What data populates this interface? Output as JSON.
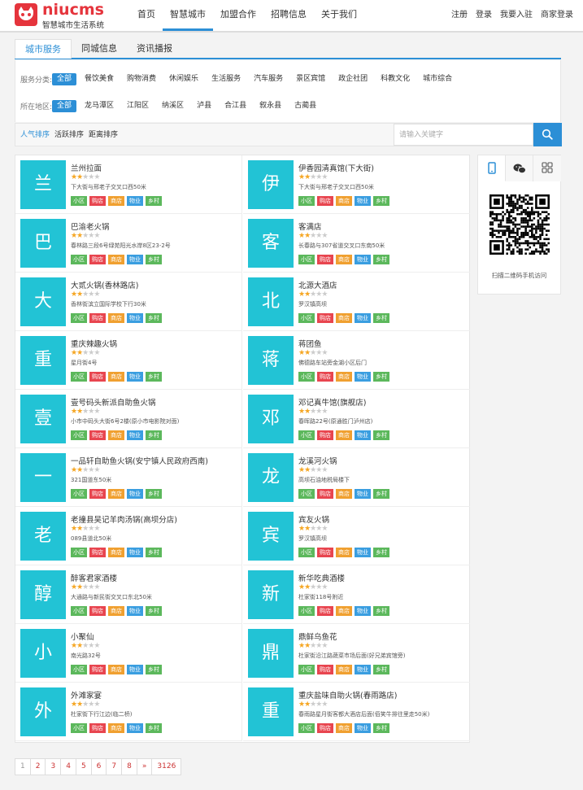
{
  "header": {
    "brand": "niucms",
    "slogan": "智慧城市生活系统",
    "nav": [
      "首页",
      "智慧城市",
      "加盟合作",
      "招聘信息",
      "关于我们"
    ],
    "nav_active": 1,
    "top_links": [
      "注册",
      "登录",
      "我要入驻",
      "商家登录"
    ]
  },
  "tabs": [
    "城市服务",
    "同城信息",
    "资讯播报"
  ],
  "filters": {
    "category_label": "服务分类:",
    "categories": [
      "全部",
      "餐饮美食",
      "购物消费",
      "休闲娱乐",
      "生活服务",
      "汽车服务",
      "景区宾馆",
      "政企社团",
      "科教文化",
      "城市综合"
    ],
    "area_label": "所在地区:",
    "areas": [
      "全部",
      "龙马潭区",
      "江阳区",
      "纳溪区",
      "泸县",
      "合江县",
      "叙永县",
      "古蔺县"
    ]
  },
  "sort": {
    "options": [
      "人气排序",
      "活跃排序",
      "距离排序"
    ],
    "search_placeholder": "请输入关键字"
  },
  "tag_labels": [
    "小区",
    "购店",
    "商店",
    "物业",
    "乡村"
  ],
  "colors": {
    "accent": "#2c8fd6",
    "tile": "#22c3d5",
    "brand": "#e5343c",
    "star": "#f5a623",
    "tags": [
      "#5cb85c",
      "#e8454f",
      "#f0a030",
      "#3a9ee0",
      "#5cb85c"
    ]
  },
  "items": [
    {
      "char": "兰",
      "name": "兰州拉面",
      "stars": 2,
      "addr": "下大街与邢老子交叉口西50米"
    },
    {
      "char": "伊",
      "name": "伊香园清真馆(下大街)",
      "stars": 2,
      "addr": "下大街与邢老子交叉口西50米"
    },
    {
      "char": "巴",
      "name": "巴渝老火锅",
      "stars": 2,
      "addr": "春林路三段6号绿苑阳光水岸8区23-2号"
    },
    {
      "char": "客",
      "name": "客满店",
      "stars": 2,
      "addr": "长春路与307省道交叉口东南50米"
    },
    {
      "char": "大",
      "name": "大贰火锅(香林路店)",
      "stars": 2,
      "addr": "香林街滨立国际学校下行30米"
    },
    {
      "char": "北",
      "name": "北源大酒店",
      "stars": 2,
      "addr": "罗汉镇高坝"
    },
    {
      "char": "重",
      "name": "重庆辣趣火锅",
      "stars": 2,
      "addr": "星月街4号"
    },
    {
      "char": "蒋",
      "name": "蒋团鱼",
      "stars": 2,
      "addr": "佛德路车站旁金湖小区后门"
    },
    {
      "char": "壹",
      "name": "壹号码头新派自助鱼火锅",
      "stars": 2,
      "addr": "小市中码头大街6号2楼(原小市电影院对面)"
    },
    {
      "char": "邓",
      "name": "邓记真牛馆(旗舰店)",
      "stars": 2,
      "addr": "春晖路22号(原通胜门泸州店)"
    },
    {
      "char": "一",
      "name": "一品轩自助鱼火锅(安宁镇人民政府西南)",
      "stars": 2,
      "addr": "321国道东50米"
    },
    {
      "char": "龙",
      "name": "龙溪河火锅",
      "stars": 2,
      "addr": "高坝石油地税局楼下"
    },
    {
      "char": "老",
      "name": "老撞县吴记羊肉汤锅(高坝分店)",
      "stars": 2,
      "addr": "089县道北50米"
    },
    {
      "char": "宾",
      "name": "宾友火锅",
      "stars": 2,
      "addr": "罗汉镇高坝"
    },
    {
      "char": "醇",
      "name": "醉客君家酒楼",
      "stars": 2,
      "addr": "大通路与新民街交叉口东北50米"
    },
    {
      "char": "新",
      "name": "新华吃典酒楼",
      "stars": 2,
      "addr": "杜家街118号附近"
    },
    {
      "char": "小",
      "name": "小聚仙",
      "stars": 2,
      "addr": "南光路32号"
    },
    {
      "char": "鼎",
      "name": "鼎鲜乌鱼花",
      "stars": 2,
      "addr": "杜家街沿江路蔬菜市场后面(好兄弟宾馆旁)"
    },
    {
      "char": "外",
      "name": "外滩家宴",
      "stars": 2,
      "addr": "杜家街下行江边(临二桥)"
    },
    {
      "char": "重",
      "name": "重庆盐味自助火锅(春雨路店)",
      "stars": 2,
      "addr": "春雨路星月街客都大酒店后面(佰笑牛排往里走50米)"
    }
  ],
  "qr": {
    "tabs": [
      "mobile-icon",
      "wechat-icon",
      "grid-icon"
    ],
    "caption": "扫描二维码手机访问"
  },
  "pager": [
    "1",
    "2",
    "3",
    "4",
    "5",
    "6",
    "7",
    "8",
    "»",
    "3126"
  ]
}
